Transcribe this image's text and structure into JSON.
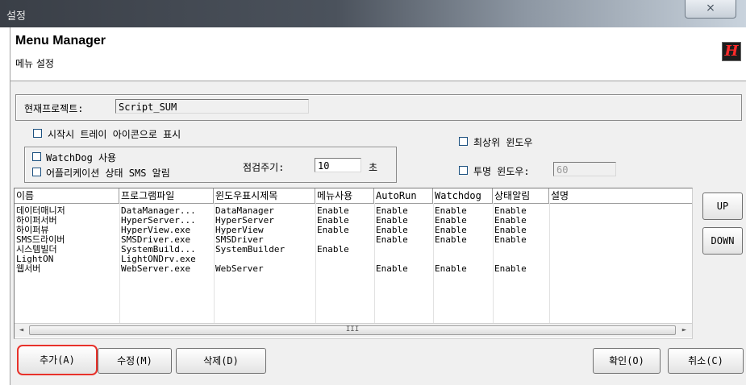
{
  "window": {
    "title": "설정",
    "close_glyph": "⨯"
  },
  "header": {
    "title": "Menu Manager",
    "subtitle": "메뉴 설정",
    "logo_letter": "H",
    "logo_color": "#ff2a2a"
  },
  "project": {
    "label": "현재프로젝트:",
    "value": "Script_SUM"
  },
  "options": {
    "tray_icon": "시작시 트레이 아이콘으로 표시",
    "topmost": "최상위 윈도우",
    "watchdog": "WatchDog 사용",
    "sms_alert": "어플리케이션 상태 SMS 알림",
    "interval_label": "점검주기:",
    "interval_value": "10",
    "interval_unit": "초",
    "transparent_label": "투명 윈도우:",
    "transparent_value": "60"
  },
  "table": {
    "columns": [
      "이름",
      "프로그램파일",
      "윈도우표시제목",
      "메뉴사용",
      "AutoRun",
      "Watchdog",
      "상태알림",
      "설명"
    ],
    "rows": [
      [
        "데이터매니저",
        "DataManager...",
        "DataManager",
        "Enable",
        "Enable",
        "Enable",
        "Enable",
        ""
      ],
      [
        "하이퍼서버",
        "HyperServer...",
        "HyperServer",
        "Enable",
        "Enable",
        "Enable",
        "Enable",
        ""
      ],
      [
        "하이퍼뷰",
        "HyperView.exe",
        "HyperView",
        "Enable",
        "Enable",
        "Enable",
        "Enable",
        ""
      ],
      [
        "SMS드라이버",
        "SMSDriver.exe",
        "SMSDriver",
        "",
        "Enable",
        "Enable",
        "Enable",
        ""
      ],
      [
        "시스템빌더",
        "SystemBuild...",
        "SystemBuilder",
        "Enable",
        "",
        "",
        "",
        ""
      ],
      [
        "LightON",
        "LightONDrv.exe",
        "",
        "",
        "",
        "",
        "",
        ""
      ],
      [
        "웹서버",
        "WebServer.exe",
        "WebServer",
        "",
        "Enable",
        "Enable",
        "Enable",
        ""
      ]
    ],
    "scroll_left": "◄",
    "scroll_right": "►",
    "scroll_grip": "III"
  },
  "side_buttons": {
    "up": "UP",
    "down": "DOWN"
  },
  "buttons": {
    "add": "추가(A)",
    "edit": "수정(M)",
    "delete": "삭제(D)",
    "ok": "확인(O)",
    "cancel": "취소(C)"
  },
  "highlight_color": "#e8322b"
}
